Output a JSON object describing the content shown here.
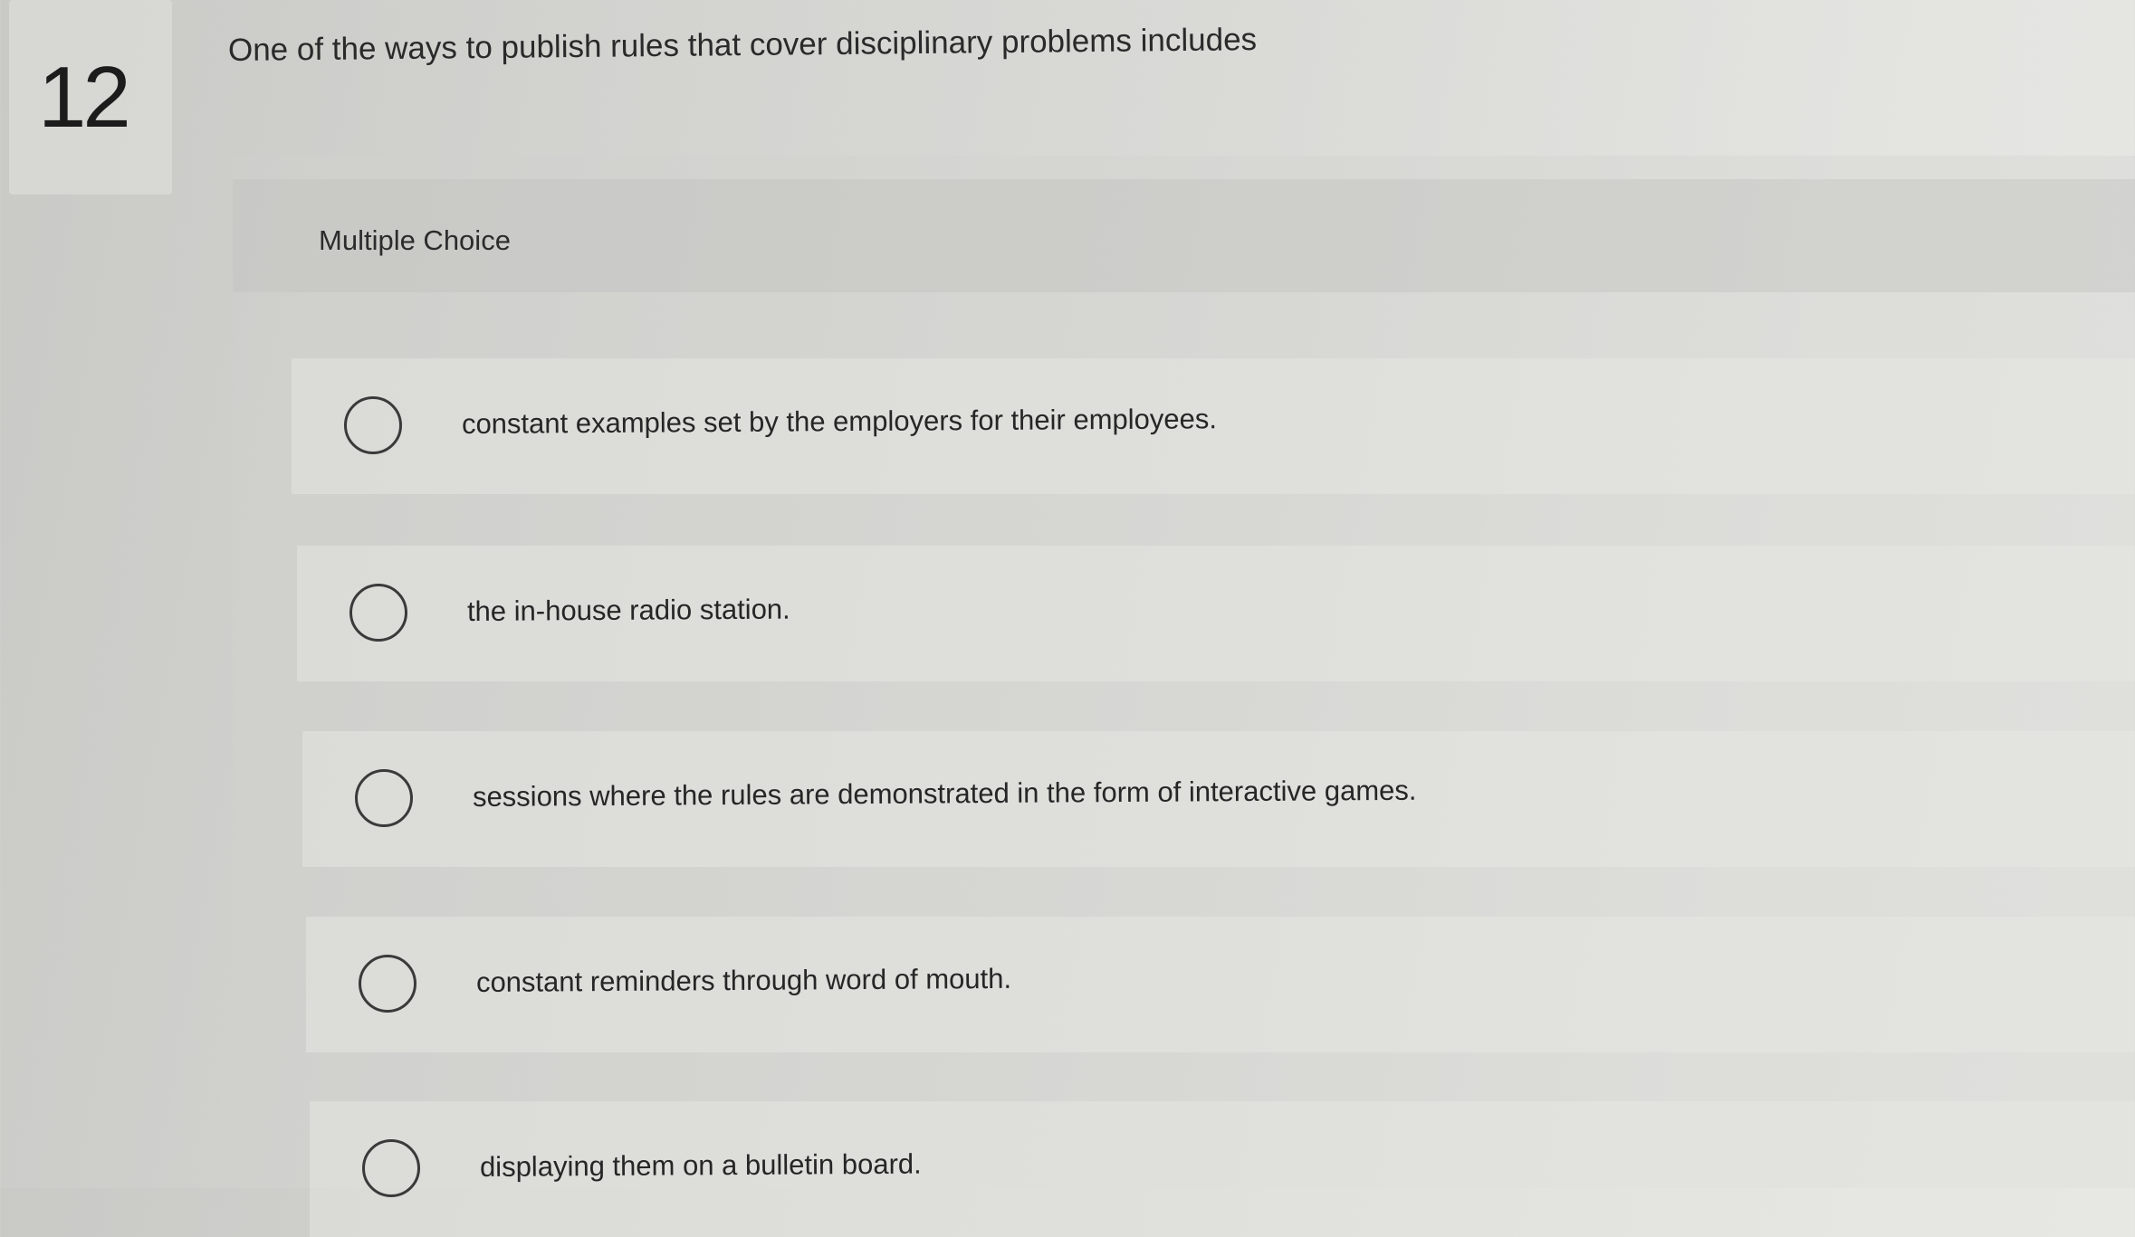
{
  "question": {
    "number": "12",
    "text": "One of the ways to publish rules that cover disciplinary problems includes"
  },
  "question_type": "Multiple Choice",
  "options": [
    {
      "label": "constant examples set by the employers for their employees.",
      "selected": false
    },
    {
      "label": "the in-house radio station.",
      "selected": false
    },
    {
      "label": "sessions where the rules are demonstrated in the form of interactive games.",
      "selected": false
    },
    {
      "label": "constant reminders through word of mouth.",
      "selected": false
    },
    {
      "label": "displaying them on a bulletin board.",
      "selected": false
    }
  ]
}
